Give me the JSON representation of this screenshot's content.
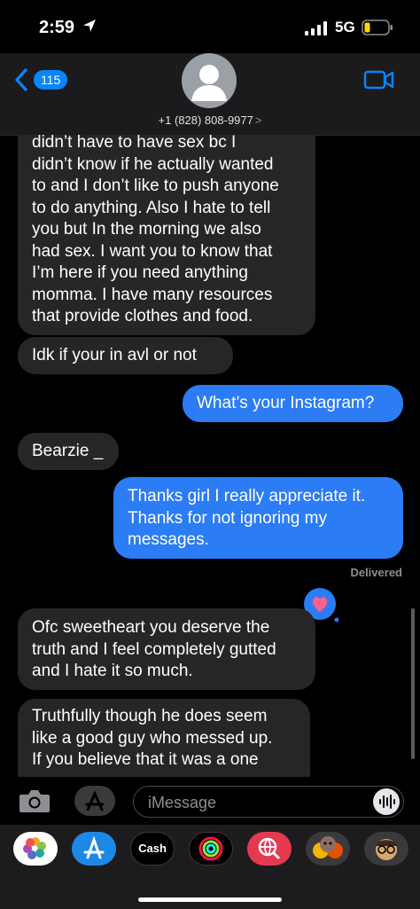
{
  "status": {
    "time": "2:59",
    "network": "5G"
  },
  "header": {
    "back_count": "115",
    "contact": "+1 (828) 808-9977",
    "contact_chevron": ">"
  },
  "messages": [
    {
      "dir": "in",
      "lines": [
        "didn’t have to have sex bc I",
        "didn’t know if he actually wanted",
        "to and I don’t like to push anyone",
        "to do anything. Also I hate to tell",
        "you but In the morning we also",
        "had sex. I want you to know that",
        "I’m here if you need anything",
        "momma. I have many resources",
        "that provide clothes and food."
      ]
    },
    {
      "dir": "in",
      "lines": [
        "Idk if your in avl  or not"
      ]
    },
    {
      "dir": "out",
      "lines": [
        "What’s your Instagram?"
      ]
    },
    {
      "dir": "in",
      "lines": [
        "Bearzie _"
      ]
    },
    {
      "dir": "out",
      "lines": [
        "Thanks girl I really appreciate it.",
        "Thanks for not ignoring my",
        "messages."
      ]
    },
    {
      "dir": "in",
      "lines": [
        "Ofc sweetheart you deserve the",
        "truth and I feel completely gutted",
        "and I hate it so much."
      ]
    },
    {
      "dir": "in",
      "lines": [
        "Truthfully though he does seem",
        "like a good guy who messed up.",
        "If you believe that it was a one"
      ]
    }
  ],
  "delivered_label": "Delivered",
  "input": {
    "placeholder": "iMessage"
  },
  "app_drawer": [
    {
      "name": "photos-app-icon"
    },
    {
      "name": "app-store-icon"
    },
    {
      "name": "apple-cash-icon",
      "label": "Cash"
    },
    {
      "name": "activity-icon"
    },
    {
      "name": "web-search-icon"
    },
    {
      "name": "memoji-stickers-icon"
    },
    {
      "name": "memoji-icon"
    }
  ],
  "colors": {
    "accent": "#0a84ff",
    "outgoing": "#2b7cf5",
    "incoming": "#262628"
  }
}
